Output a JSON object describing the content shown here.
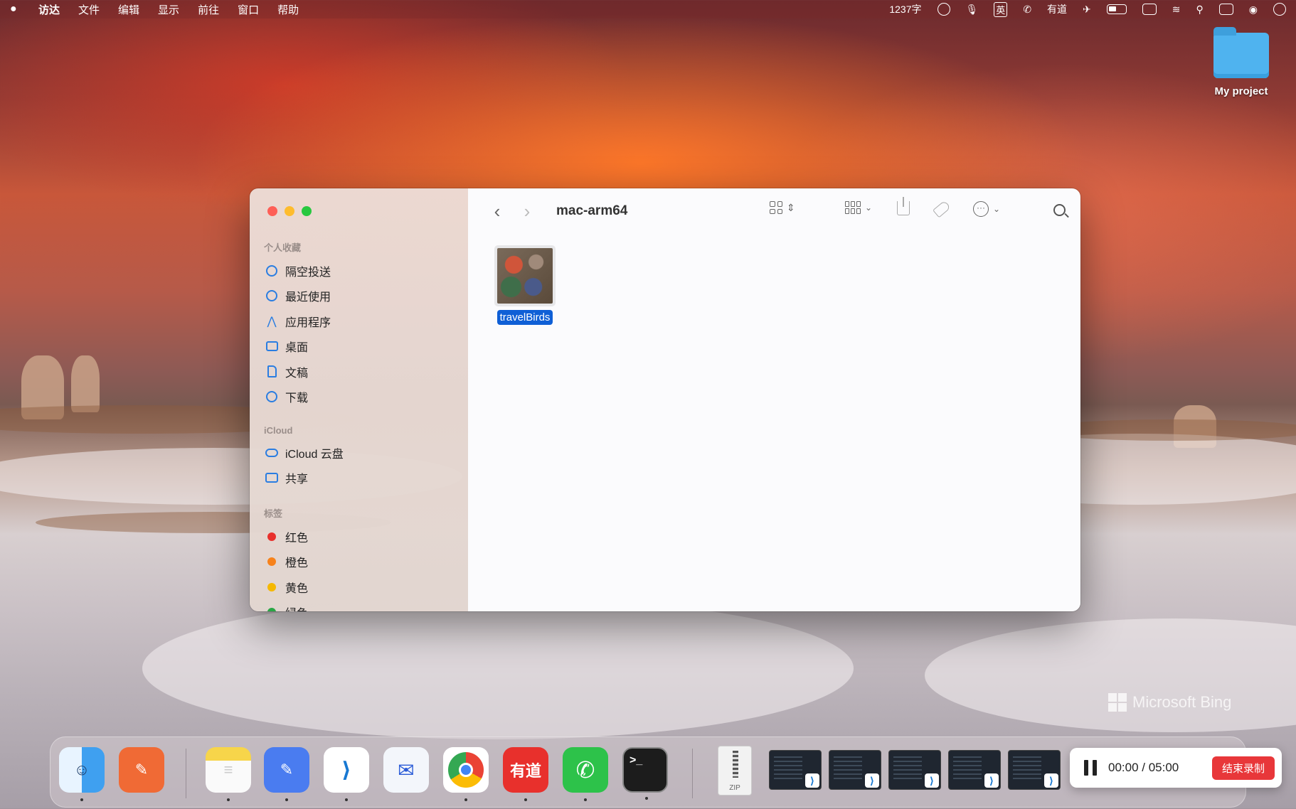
{
  "menubar": {
    "app": "访达",
    "items": [
      "文件",
      "编辑",
      "显示",
      "前往",
      "窗口",
      "帮助"
    ],
    "word_count": "1237字",
    "ime": "英",
    "youdao": "有道"
  },
  "desktop": {
    "folder_label": "My project",
    "watermark": "Microsoft Bing"
  },
  "finder": {
    "title": "mac-arm64",
    "sidebar": {
      "favorites_title": "个人收藏",
      "favorites": [
        {
          "label": "隔空投送",
          "icon": "airdrop-icon"
        },
        {
          "label": "最近使用",
          "icon": "clock-icon"
        },
        {
          "label": "应用程序",
          "icon": "applications-icon"
        },
        {
          "label": "桌面",
          "icon": "desktop-icon"
        },
        {
          "label": "文稿",
          "icon": "document-icon"
        },
        {
          "label": "下载",
          "icon": "download-icon"
        }
      ],
      "icloud_title": "iCloud",
      "icloud": [
        {
          "label": "iCloud 云盘",
          "icon": "cloud-icon"
        },
        {
          "label": "共享",
          "icon": "shared-folder-icon"
        }
      ],
      "tags_title": "标签",
      "tags": [
        {
          "label": "红色",
          "color": "#e8302c"
        },
        {
          "label": "橙色",
          "color": "#f7821b"
        },
        {
          "label": "黄色",
          "color": "#f5b800"
        },
        {
          "label": "绿色",
          "color": "#29a745"
        }
      ]
    },
    "files": [
      {
        "name": "travelBirds",
        "selected": true
      }
    ]
  },
  "dock": {
    "apps": [
      {
        "name": "finder",
        "color": "#3fa0f0",
        "glyph": "☺"
      },
      {
        "name": "postman",
        "color": "#f06a35",
        "glyph": "✎"
      },
      {
        "name": "notes",
        "color": "#f7d54a",
        "glyph": "≡"
      },
      {
        "name": "editor",
        "color": "#4a7cf0",
        "glyph": "✎"
      },
      {
        "name": "vscode",
        "color": "#ffffff",
        "glyph": "⟩"
      },
      {
        "name": "mail-app",
        "color": "#f3f6fb",
        "glyph": "✉"
      },
      {
        "name": "chrome",
        "color": "#ffffff",
        "glyph": "◉"
      },
      {
        "name": "youdao",
        "color": "#e8302c",
        "glyph": "有道"
      },
      {
        "name": "wechat",
        "color": "#2dc24a",
        "glyph": "✆"
      },
      {
        "name": "terminal",
        "color": "#1c1c1c",
        "glyph": ">_"
      }
    ],
    "zip_label": "ZIP",
    "recorder": {
      "time": "00:00 / 05:00",
      "stop_label": "结束录制"
    }
  }
}
